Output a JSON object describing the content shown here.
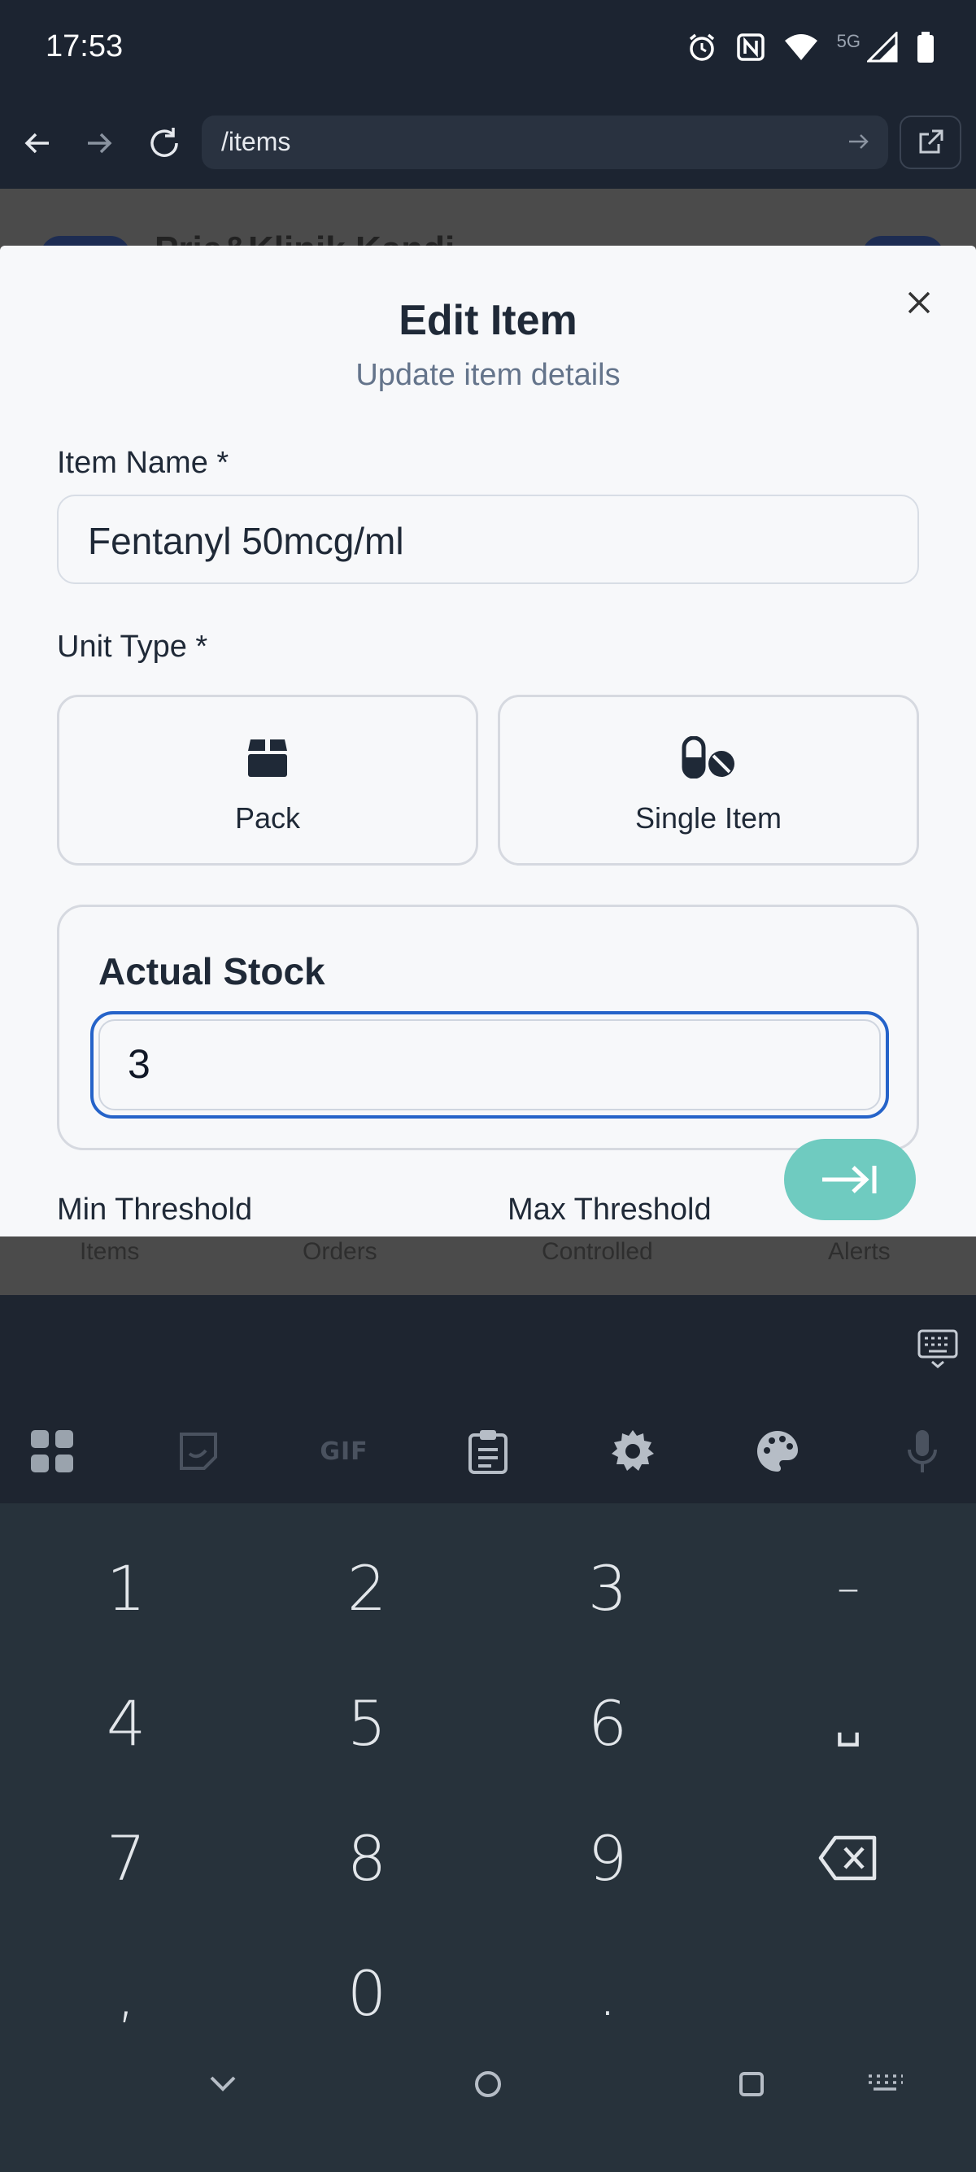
{
  "status_bar": {
    "time": "17:53",
    "network": "5G"
  },
  "browser": {
    "url": "/items"
  },
  "background_page": {
    "title": "Prie&Klinik Kandi...",
    "nav_items": [
      "Items",
      "Orders",
      "Controlled",
      "Alerts"
    ]
  },
  "modal": {
    "title": "Edit Item",
    "subtitle": "Update item details",
    "item_name_label": "Item Name *",
    "item_name_value": "Fentanyl 50mcg/ml",
    "unit_type_label": "Unit Type *",
    "unit_options": [
      {
        "label": "Pack",
        "icon": "box-icon"
      },
      {
        "label": "Single Item",
        "icon": "pills-icon"
      }
    ],
    "actual_stock_label": "Actual Stock",
    "actual_stock_value": "3",
    "min_threshold_label": "Min Threshold",
    "max_threshold_label": "Max Threshold"
  },
  "keyboard": {
    "keys": [
      "1",
      "2",
      "3",
      "–",
      "4",
      "5",
      "6",
      "␣",
      "7",
      "8",
      "9",
      "⌫",
      ",",
      "0",
      ".",
      "⇥"
    ],
    "gif_label": "GIF",
    "enter_color": "#6fcbc0"
  }
}
